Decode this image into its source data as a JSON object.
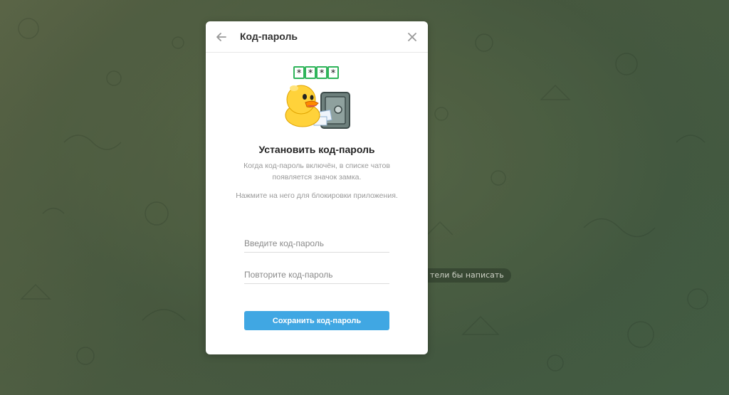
{
  "background": {
    "chat_hint": "тели бы написать"
  },
  "modal": {
    "title": "Код-пароль",
    "back_icon": "arrow-left-icon",
    "close_icon": "close-icon",
    "sticker": {
      "name": "duck-with-safe-sticker",
      "code_glyphs": [
        "*",
        "*",
        "*",
        "*"
      ]
    },
    "heading": "Установить код-пароль",
    "description_1": "Когда код-пароль включён, в списке чатов появляется значок замка.",
    "description_2": "Нажмите на него для блокировки приложения.",
    "fields": {
      "new_placeholder": "Введите код-пароль",
      "repeat_placeholder": "Повторите код-пароль"
    },
    "save_label": "Сохранить код-пароль"
  },
  "colors": {
    "accent": "#40a7e3",
    "background": "#55684a"
  }
}
